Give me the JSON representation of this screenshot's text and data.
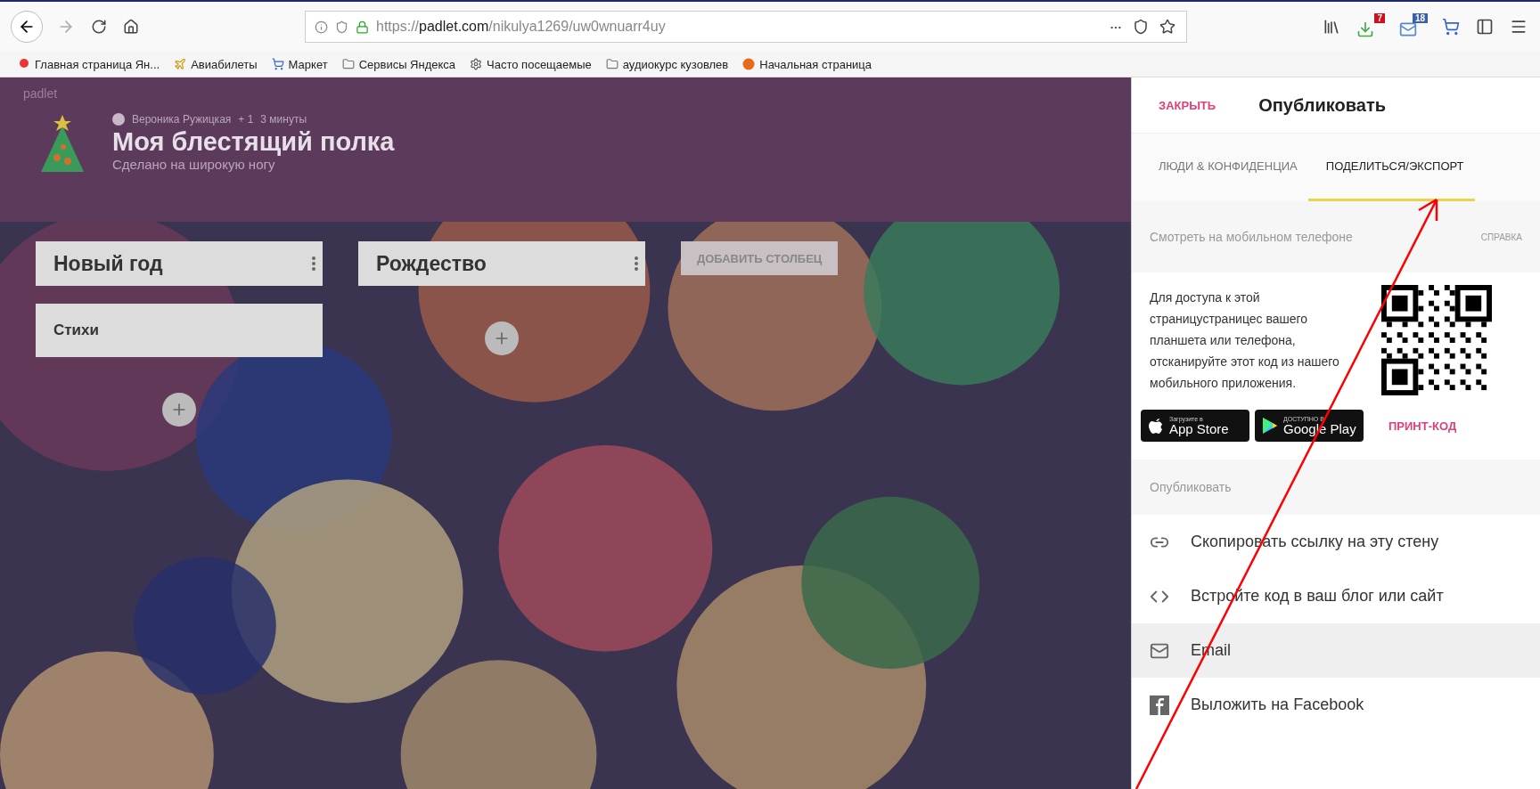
{
  "browser": {
    "url_prefix": "https://",
    "url_host": "padlet.com",
    "url_path": "/nikulya1269/uw0wnuarr4uy",
    "more": "···",
    "badges": [
      {
        "kind": "download",
        "text": "7"
      },
      {
        "kind": "mail",
        "text": "18"
      }
    ],
    "bookmarks": [
      {
        "kind": "yandex",
        "label": "Главная страница Ян..."
      },
      {
        "kind": "plane",
        "label": "Авиабилеты"
      },
      {
        "kind": "cart",
        "label": "Маркет"
      },
      {
        "kind": "folder",
        "label": "Сервисы Яндекса"
      },
      {
        "kind": "gear",
        "label": "Часто посещаемые"
      },
      {
        "kind": "folder",
        "label": "аудиокурс кузовлев"
      },
      {
        "kind": "firefox",
        "label": "Начальная страница"
      }
    ]
  },
  "padlet": {
    "brand": "padlet",
    "author": "Вероника Ружицкая",
    "plus": "+ 1",
    "time": "3 минуты",
    "title": "Моя блестящий полка",
    "subtitle": "Сделано на широкую ногу",
    "columns": [
      {
        "title": "Новый год",
        "posts": [
          "Стихи"
        ]
      },
      {
        "title": "Рождество"
      }
    ],
    "add_column": "ДОБАВИТЬ СТОЛБЕЦ"
  },
  "panel": {
    "close": "ЗАКРЫТЬ",
    "title": "Опубликовать",
    "tabs": [
      {
        "label": "ЛЮДИ & КОНФИДЕНЦИА",
        "selected": false
      },
      {
        "label": "ПОДЕЛИТЬСЯ/ЭКСПОРТ",
        "selected": true
      }
    ],
    "mobile": {
      "heading": "Смотреть на мобильном телефоне",
      "help": "СПРАВКА",
      "text": "Для доступа к этой страницустраницес вашего планшета или телефона, отсканируйте этот код из нашего мобильного приложения.",
      "stores": [
        {
          "kind": "apple",
          "small": "Загрузите в",
          "big": "App Store"
        },
        {
          "kind": "google",
          "small": "ДОСТУПНО В",
          "big": "Google Play"
        }
      ],
      "print": "ПРИНТ-КОД"
    },
    "publish_heading": "Опубликовать",
    "actions": [
      {
        "kind": "link",
        "label": "Скопировать ссылку на эту стену",
        "highlighted": false
      },
      {
        "kind": "code",
        "label": "Встройте код в ваш блог или сайт",
        "highlighted": false
      },
      {
        "kind": "email",
        "label": "Email",
        "highlighted": true
      },
      {
        "kind": "facebook",
        "label": "Выложить на Facebook",
        "highlighted": false
      }
    ]
  }
}
